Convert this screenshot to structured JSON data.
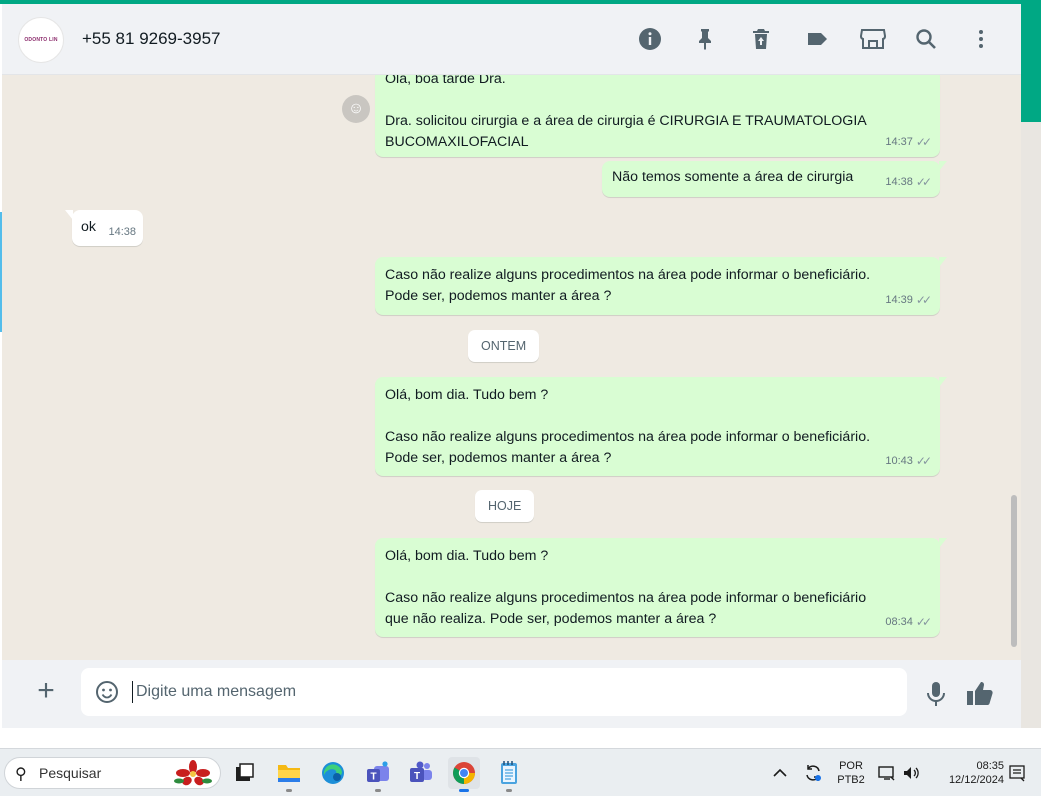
{
  "header": {
    "avatar_text": "ODONTO LIN",
    "contact_name": "+55 81 9269-3957",
    "icons": [
      "info-icon",
      "pin-icon",
      "delete-icon",
      "label-icon",
      "catalog-icon",
      "search-icon",
      "menu-icon"
    ]
  },
  "messages": [
    {
      "id": "m1",
      "direction": "out",
      "text": "Olá, boa tarde Dra.\n\nDra. solicitou cirurgia e a área de cirurgia é CIRURGIA E TRAUMATOLOGIA\nBUCOMAXILOFACIAL",
      "time": "14:37"
    },
    {
      "id": "m2",
      "direction": "out",
      "text": "Não temos somente a área de cirurgia",
      "time": "14:38"
    },
    {
      "id": "m3",
      "direction": "in",
      "text": "ok",
      "time": "14:38"
    },
    {
      "id": "m4",
      "direction": "out",
      "text": "Caso não realize alguns procedimentos na área pode informar o beneficiário.\nPode ser, podemos manter a área ?",
      "time": "14:39"
    },
    {
      "id": "m5",
      "direction": "out",
      "text": "Olá, bom dia. Tudo bem ?\n\nCaso não realize alguns procedimentos na área pode informar o beneficiário.\nPode ser, podemos manter a área ?",
      "time": "10:43"
    },
    {
      "id": "m6",
      "direction": "out",
      "text": "Olá, bom dia. Tudo bem ?\n\nCaso não realize alguns procedimentos na área pode informar o beneficiário\nque não realiza. Pode ser, podemos manter a área ?",
      "time": "08:34"
    }
  ],
  "dividers": {
    "yesterday": "ONTEM",
    "today": "HOJE"
  },
  "composer": {
    "placeholder": "Digite uma mensagem"
  },
  "taskbar": {
    "search_label": "Pesquisar",
    "language": "POR",
    "layout": "PTB2",
    "time": "08:35",
    "date": "12/12/2024"
  },
  "colors": {
    "accent": "#00a884",
    "outgoing": "#d9fdd3",
    "incoming": "#ffffff",
    "chat_bg": "#efeae2"
  }
}
